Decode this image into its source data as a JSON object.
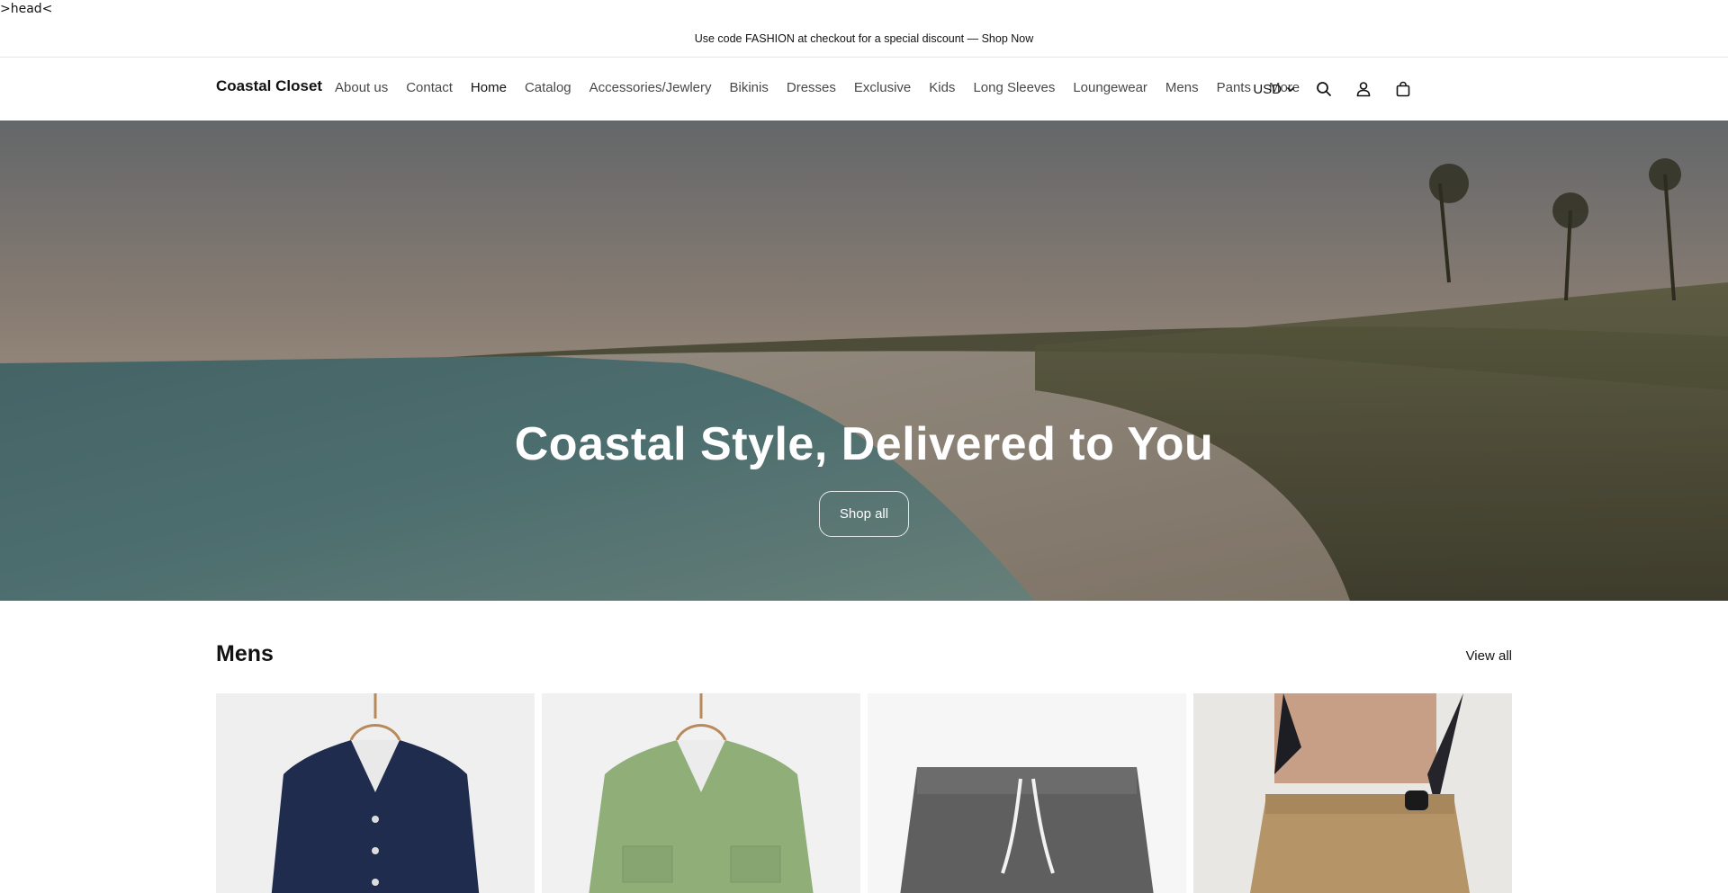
{
  "stray_text": ">head<",
  "announcement": {
    "text": "Use code FASHION at checkout for a special discount — Shop Now"
  },
  "header": {
    "logo": "Coastal Closet",
    "nav": [
      {
        "label": "About us"
      },
      {
        "label": "Contact"
      },
      {
        "label": "Home",
        "active": true
      },
      {
        "label": "Catalog"
      },
      {
        "label": "Accessories/Jewlery"
      },
      {
        "label": "Bikinis"
      },
      {
        "label": "Dresses"
      },
      {
        "label": "Exclusive"
      },
      {
        "label": "Kids"
      },
      {
        "label": "Long Sleeves"
      },
      {
        "label": "Loungewear"
      },
      {
        "label": "Mens"
      },
      {
        "label": "Pants"
      },
      {
        "label": "More"
      }
    ],
    "currency": "USD",
    "icons": [
      "chevron-down-icon",
      "search-icon",
      "account-icon",
      "cart-icon"
    ]
  },
  "hero": {
    "title": "Coastal Style, Delivered to You",
    "button_label": "Shop all"
  },
  "collection": {
    "title": "Mens",
    "view_all_label": "View all",
    "products": [
      {
        "image": "navy-shirt"
      },
      {
        "image": "green-shirt"
      },
      {
        "image": "grey-shorts"
      },
      {
        "image": "khaki-pants"
      }
    ]
  },
  "colors": {
    "text": "#121212",
    "background": "#ffffff",
    "border": "#e6e6e6"
  }
}
